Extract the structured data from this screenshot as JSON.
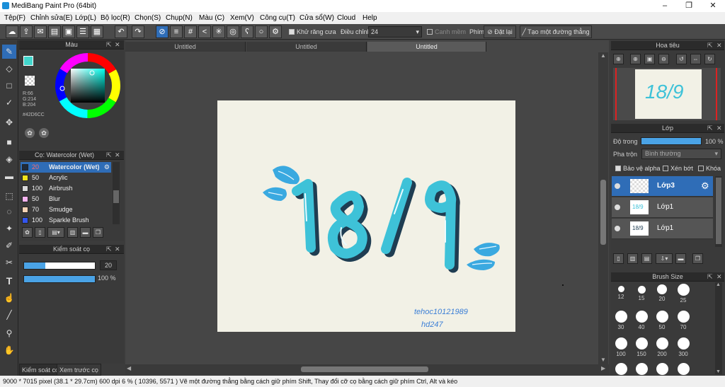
{
  "window": {
    "title": "MediBang Paint Pro (64bit)",
    "minimize": "–",
    "maximize": "❐",
    "close": "✕"
  },
  "menu": [
    "Tệp(F)",
    "Chỉnh sửa(E)",
    "Lớp(L)",
    "Bộ lọc(R)",
    "Chọn(S)",
    "Chụp(N)",
    "Màu (C)",
    "Xem(V)",
    "Công cụ(T)",
    "Cửa sổ(W)",
    "Cloud",
    "Help"
  ],
  "toolbar": {
    "antialias_label": "Khử răng cưa",
    "correction_label": "Điều chỉnh",
    "correction_value": "24",
    "canhmem_label": "Canh mềm",
    "phim_label": "Phím",
    "reset_label": "Đặt lại",
    "line_label": "Tạo một đường thẳng"
  },
  "color_panel": {
    "title": "Màu",
    "r": "R:66",
    "g": "G:214",
    "b": "B:204",
    "hex": "#42D6CC",
    "fg_color": "#42d6cc"
  },
  "brush_panel": {
    "title": "Cọ: Watercolor (Wet)",
    "brushes": [
      {
        "size": "20",
        "name": "Watercolor (Wet)",
        "color": "#1e2a3a"
      },
      {
        "size": "50",
        "name": "Acrylic",
        "color": "#f2e21c"
      },
      {
        "size": "100",
        "name": "Airbrush",
        "color": "#d9d9d9"
      },
      {
        "size": "50",
        "name": "Blur",
        "color": "#f6b3f0"
      },
      {
        "size": "70",
        "name": "Smudge",
        "color": "#f5d2b4"
      },
      {
        "size": "100",
        "name": "Sparkle Brush",
        "color": "#3355ee"
      }
    ]
  },
  "control_panel": {
    "title": "Kiểm soát cọ",
    "size_value": "20",
    "opacity_value": "100 %",
    "size_fraction": 0.3,
    "opacity_fraction": 1.0
  },
  "bottom_tabs": [
    "Kiểm soát cọ",
    "Xem trước cọ"
  ],
  "doc_tabs": [
    "Untitled",
    "Untitled",
    "Untitled"
  ],
  "navigator": {
    "title": "Hoa tiêu"
  },
  "layer_panel": {
    "title": "Lớp",
    "opacity_label": "Độ trong",
    "opacity_value": "100 %",
    "blend_label": "Pha trộn",
    "blend_value": "Bình thường",
    "protect_alpha": "Bảo vệ alpha",
    "clipping": "Xén bớt",
    "lock": "Khóa",
    "layers": [
      "Lớp3",
      "Lớp1",
      "Lớp1"
    ]
  },
  "brush_size_panel": {
    "title": "Brush Size",
    "sizes": [
      "12",
      "15",
      "20",
      "25",
      "30",
      "40",
      "50",
      "70",
      "100",
      "150",
      "200",
      "300"
    ]
  },
  "canvas_art": {
    "number_text": "18/9",
    "sign_line1": "tehoc10121989",
    "sign_line2": "hd247"
  },
  "status": "9000 * 7015 pixel  (38.1 * 29.7cm)  600 dpi  6 %  ( 10396, 5571 )  Vẽ một đường thẳng bằng cách giữ phím Shift, Thay đổi cỡ cọ bằng cách giữ phím Ctrl, Alt và kéo"
}
